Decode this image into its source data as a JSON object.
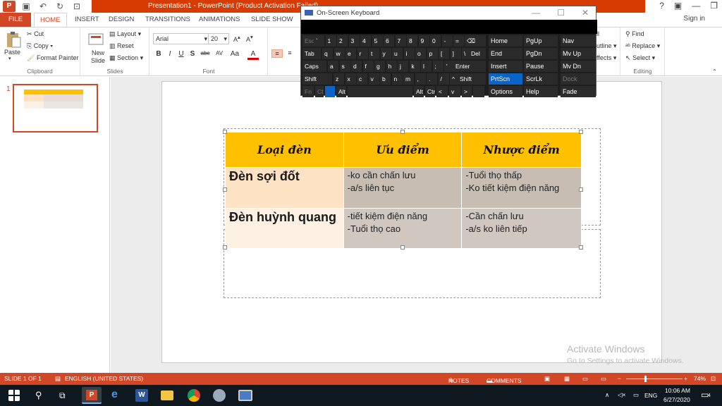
{
  "window": {
    "title": "Presentation1 - PowerPoint (Product Activation Failed)",
    "signin": "Sign in"
  },
  "tabs": [
    "FILE",
    "HOME",
    "INSERT",
    "DESIGN",
    "TRANSITIONS",
    "ANIMATIONS",
    "SLIDE SHOW"
  ],
  "ribbon": {
    "clipboard": {
      "paste": "Paste",
      "cut": "Cut",
      "copy": "Copy",
      "format_painter": "Format Painter",
      "label": "Clipboard"
    },
    "slides": {
      "new_slide": "New Slide",
      "layout": "Layout",
      "reset": "Reset",
      "section": "Section",
      "label": "Slides"
    },
    "font": {
      "name": "Arial",
      "size": "20",
      "label": "Font"
    },
    "editing": {
      "find": "Find",
      "replace": "Replace",
      "select": "Select",
      "label": "Editing"
    },
    "partial": {
      "fill": "ll",
      "outline": "utline",
      "effects": "ffects"
    }
  },
  "slide_pane": {
    "number": "1"
  },
  "table": {
    "headers": [
      "Loại đèn",
      "Ưu điểm",
      "Nhược điểm"
    ],
    "rows": [
      {
        "type": "Đèn sợi đốt",
        "pros": [
          "-ko cần chấn lưu",
          "-a/s liên tục"
        ],
        "cons": [
          "-Tuổi thọ thấp",
          "-Ko tiết kiệm điện năng"
        ]
      },
      {
        "type": "Đèn huỳnh quang",
        "pros": [
          "-tiết kiệm điện năng",
          "-Tuổi thọ cao"
        ],
        "cons": [
          "-Cần chấn lưu",
          "-a/s ko liên tiếp"
        ]
      }
    ]
  },
  "watermark": {
    "line1": "Activate Windows",
    "line2": "Go to Settings to activate Windows."
  },
  "osk": {
    "title": "On-Screen Keyboard",
    "nav_keys": [
      "Home",
      "PgUp",
      "Nav",
      "End",
      "PgDn",
      "Mv Up",
      "Insert",
      "Pause",
      "Mv Dn",
      "PrtScn",
      "ScrLk",
      "Dock",
      "Options",
      "Help",
      "Fade"
    ],
    "row1": [
      "Esc",
      "`",
      "1",
      "2",
      "3",
      "4",
      "5",
      "6",
      "7",
      "8",
      "9",
      "0",
      "-",
      "=",
      "⌫"
    ],
    "row2": [
      "Tab",
      "q",
      "w",
      "e",
      "r",
      "t",
      "y",
      "u",
      "i",
      "o",
      "p",
      "[",
      "]",
      "\\",
      "Del"
    ],
    "row3": [
      "Caps",
      "a",
      "s",
      "d",
      "f",
      "g",
      "h",
      "j",
      "k",
      "l",
      ";",
      "'",
      "Enter"
    ],
    "row4": [
      "Shift",
      "z",
      "x",
      "c",
      "v",
      "b",
      "n",
      "m",
      ",",
      ".",
      "/",
      "^",
      "Shift"
    ],
    "row5": [
      "Fn",
      "Ctrl",
      "",
      "Alt",
      "",
      "Alt",
      "Ctrl",
      "<",
      "v",
      ">",
      ""
    ]
  },
  "status": {
    "slide": "SLIDE 1 OF 1",
    "language": "ENGLISH (UNITED STATES)",
    "notes": "NOTES",
    "comments": "COMMENTS",
    "zoom": "74%"
  },
  "taskbar": {
    "time": "10:06 AM",
    "date": "6/27/2020",
    "lang": "ENG",
    "notif": "4"
  }
}
